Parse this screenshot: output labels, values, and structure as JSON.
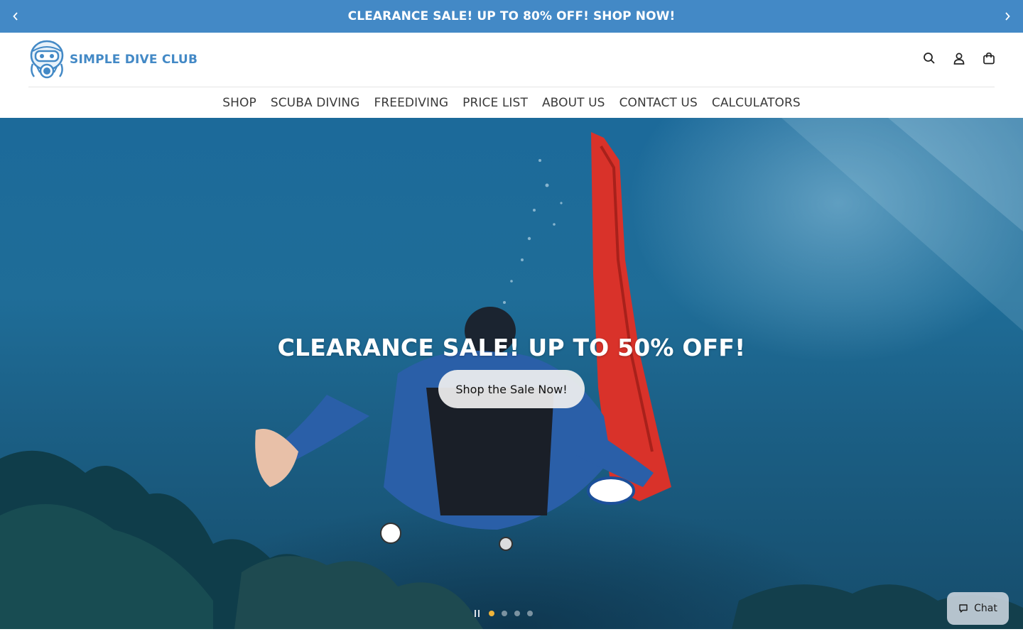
{
  "announcement": {
    "text": "CLEARANCE SALE! UP TO 80% OFF! SHOP NOW!",
    "prev_icon": "chevron-left-icon",
    "next_icon": "chevron-right-icon",
    "background": "#4389c6"
  },
  "header": {
    "logo_text": "SIMPLE DIVE CLUB",
    "icons": [
      "search-icon",
      "account-icon",
      "cart-icon"
    ]
  },
  "nav": {
    "items": [
      {
        "label": "SHOP"
      },
      {
        "label": "SCUBA DIVING"
      },
      {
        "label": "FREEDIVING"
      },
      {
        "label": "PRICE LIST"
      },
      {
        "label": "ABOUT US"
      },
      {
        "label": "CONTACT US"
      },
      {
        "label": "CALCULATORS"
      }
    ]
  },
  "hero": {
    "title": "CLEARANCE SALE! UP TO 50% OFF!",
    "button_label": "Shop the Sale Now!",
    "slides": 4,
    "active_slide": 1,
    "dot_active_color": "#f0b43a"
  },
  "chat": {
    "label": "Chat",
    "icon": "chat-bubble-icon"
  }
}
